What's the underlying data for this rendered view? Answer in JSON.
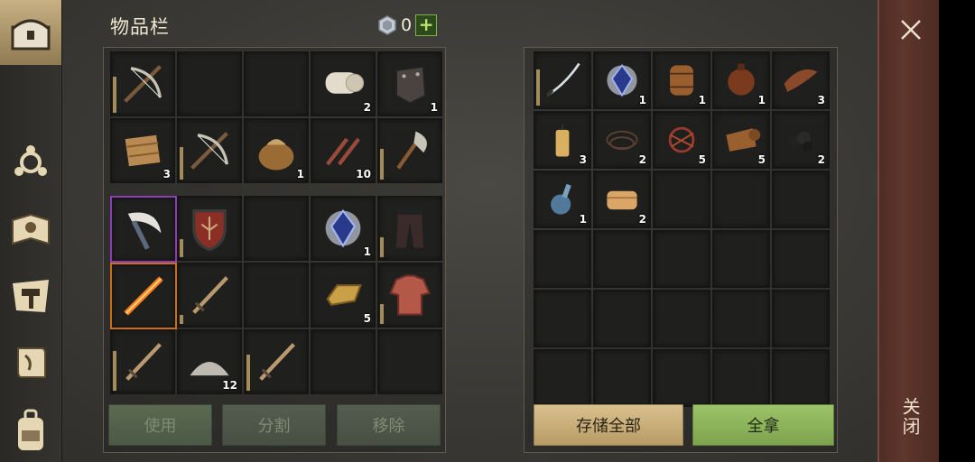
{
  "inventory": {
    "title": "物品栏",
    "gem_count": "0",
    "plus_label": "+",
    "rows": [
      [
        {
          "item": "crossbow",
          "qty": ""
        },
        {
          "item": "",
          "qty": ""
        },
        {
          "item": "",
          "qty": ""
        },
        {
          "item": "cloth-roll",
          "qty": "2"
        },
        {
          "item": "leather-armor-piece",
          "qty": "1"
        }
      ],
      [
        {
          "item": "rope-fabric",
          "qty": "3"
        },
        {
          "item": "crossbow",
          "qty": ""
        },
        {
          "item": "sack",
          "qty": "1"
        },
        {
          "item": "nails",
          "qty": "10"
        },
        {
          "item": "axe",
          "qty": ""
        }
      ],
      [
        {
          "item": "scythe",
          "qty": ""
        },
        {
          "item": "shield",
          "qty": ""
        },
        {
          "item": "",
          "qty": ""
        },
        {
          "item": "crystal",
          "qty": "1"
        },
        {
          "item": "pants",
          "qty": ""
        }
      ],
      [
        {
          "item": "flame-sword",
          "qty": ""
        },
        {
          "item": "sword",
          "qty": ""
        },
        {
          "item": "",
          "qty": ""
        },
        {
          "item": "ingot",
          "qty": "5"
        },
        {
          "item": "shirt",
          "qty": ""
        }
      ],
      [
        {
          "item": "sword",
          "qty": ""
        },
        {
          "item": "gravel-pile",
          "qty": "12"
        },
        {
          "item": "sword",
          "qty": ""
        },
        {
          "item": "",
          "qty": ""
        },
        {
          "item": "",
          "qty": ""
        }
      ]
    ],
    "buttons": {
      "use": "使用",
      "split": "分割",
      "remove": "移除"
    }
  },
  "storage": {
    "rows": [
      [
        {
          "item": "katana",
          "qty": ""
        },
        {
          "item": "crystal",
          "qty": "1"
        },
        {
          "item": "barrel",
          "qty": "1"
        },
        {
          "item": "flask",
          "qty": "1"
        },
        {
          "item": "leather-strip",
          "qty": "3"
        }
      ],
      [
        {
          "item": "candle",
          "qty": "3"
        },
        {
          "item": "rope",
          "qty": "2"
        },
        {
          "item": "twine-pile",
          "qty": "5"
        },
        {
          "item": "leather-roll",
          "qty": "5"
        },
        {
          "item": "coal",
          "qty": "2"
        }
      ],
      [
        {
          "item": "bottle",
          "qty": "1"
        },
        {
          "item": "cloth",
          "qty": "2"
        },
        {
          "item": "",
          "qty": ""
        },
        {
          "item": "",
          "qty": ""
        },
        {
          "item": "",
          "qty": ""
        }
      ],
      [
        {
          "item": "",
          "qty": ""
        },
        {
          "item": "",
          "qty": ""
        },
        {
          "item": "",
          "qty": ""
        },
        {
          "item": "",
          "qty": ""
        },
        {
          "item": "",
          "qty": ""
        }
      ],
      [
        {
          "item": "",
          "qty": ""
        },
        {
          "item": "",
          "qty": ""
        },
        {
          "item": "",
          "qty": ""
        },
        {
          "item": "",
          "qty": ""
        },
        {
          "item": "",
          "qty": ""
        }
      ],
      [
        {
          "item": "",
          "qty": ""
        },
        {
          "item": "",
          "qty": ""
        },
        {
          "item": "",
          "qty": ""
        },
        {
          "item": "",
          "qty": ""
        },
        {
          "item": "",
          "qty": ""
        }
      ]
    ],
    "buttons": {
      "store_all": "存储全部",
      "take_all": "全拿"
    }
  },
  "sidebar": {
    "items": [
      "chest-icon",
      "radiation-icon",
      "sun-book-icon",
      "map-hammer-icon",
      "scroll-icon",
      "backpack-icon"
    ]
  },
  "close": {
    "label": "关闭"
  },
  "colors": {
    "accent_green": "#9cc368",
    "accent_tan": "#d9c08d",
    "selected_purple": "#8c3fb5",
    "selected_orange": "#c86f1b"
  }
}
